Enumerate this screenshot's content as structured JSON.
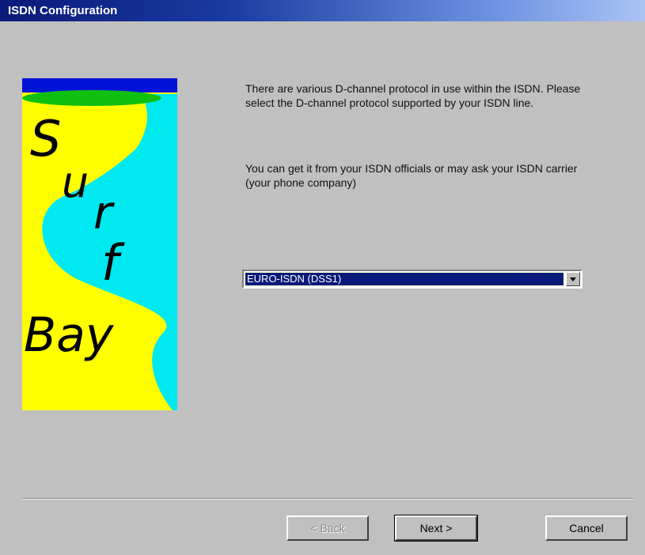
{
  "window": {
    "title": "ISDN Configuration"
  },
  "banner": {
    "letters": [
      "S",
      "u",
      "r",
      "f"
    ],
    "word": "Bay",
    "colors": {
      "sky": "#0014d8",
      "sand": "#ffff00",
      "water": "#00e8f0",
      "ellipse": "#10c010"
    }
  },
  "content": {
    "paragraph1": "There are various D-channel protocol in use within the ISDN. Please select the D-channel protocol supported by your ISDN line.",
    "paragraph2": "You can get it from your ISDN officials or may ask your ISDN carrier (your phone company)"
  },
  "protocol_select": {
    "value": "EURO-ISDN (DSS1)"
  },
  "buttons": {
    "back": "< Back",
    "next": "Next >",
    "cancel": "Cancel"
  }
}
